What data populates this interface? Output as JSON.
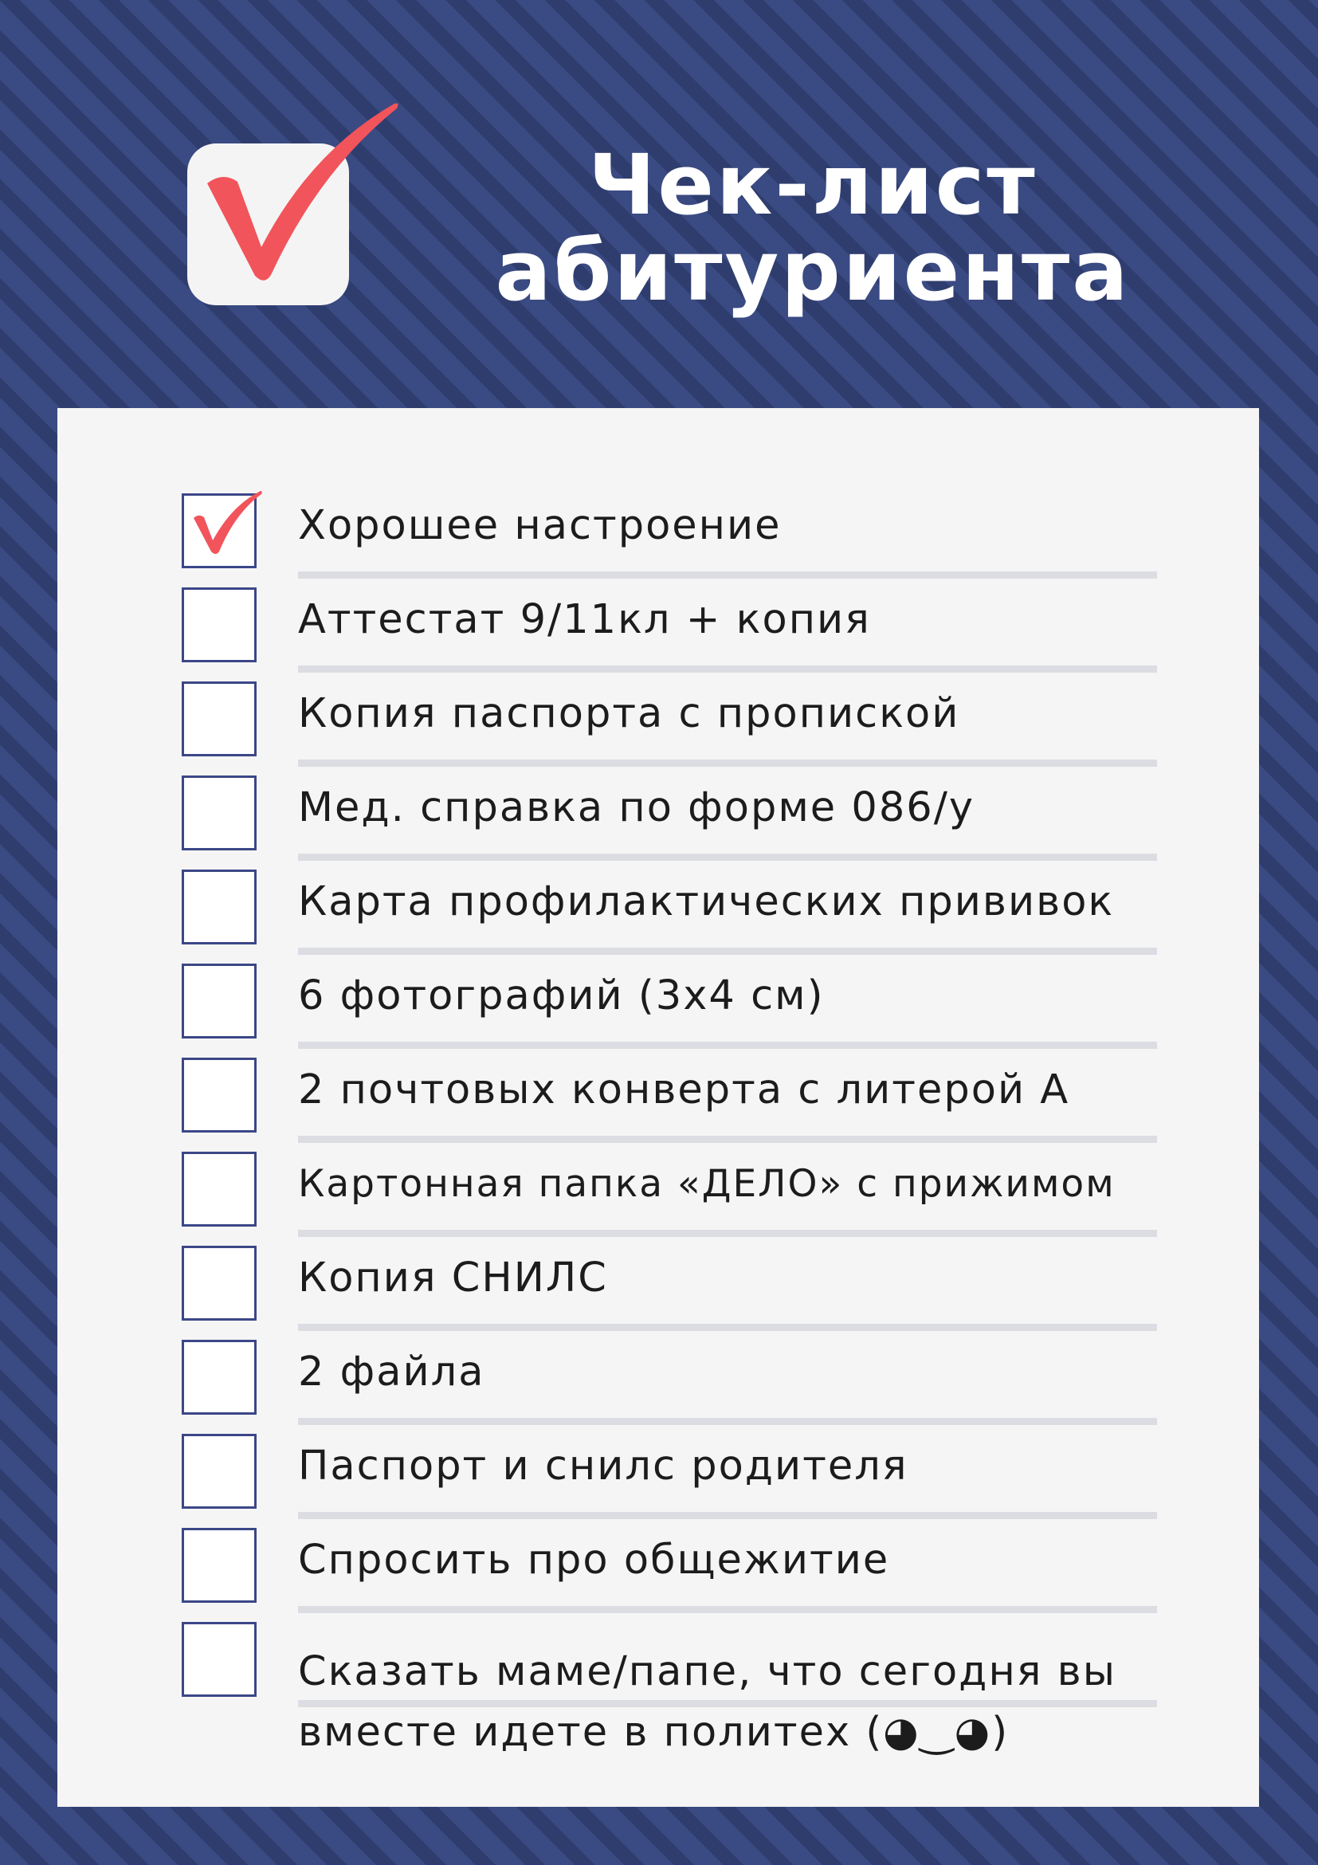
{
  "header": {
    "title_line1": "Чек-лист",
    "title_line2": "абитуриента",
    "logo_icon": "checkmark-icon",
    "accent_color": "#f2545b"
  },
  "checklist": {
    "items": [
      {
        "label": "Хорошее настроение",
        "checked": true
      },
      {
        "label": "Аттестат 9/11кл + копия",
        "checked": false
      },
      {
        "label": "Копия паспорта с пропиской",
        "checked": false
      },
      {
        "label": "Мед. справка по форме 086/у",
        "checked": false
      },
      {
        "label": "Карта профилактических прививок",
        "checked": false
      },
      {
        "label": "6 фотографий (3х4 см)",
        "checked": false
      },
      {
        "label": "2 почтовых конверта с литерой А",
        "checked": false
      },
      {
        "label": "Картонная папка «ДЕЛО» с прижимом",
        "checked": false
      },
      {
        "label": "Копия СНИЛС",
        "checked": false
      },
      {
        "label": "2 файла",
        "checked": false
      },
      {
        "label": "Паспорт и снилс родителя",
        "checked": false
      },
      {
        "label": "Спросить про общежитие",
        "checked": false
      },
      {
        "label": "Сказать маме/папе, что сегодня вы вместе идете в политех (◕‿◕)",
        "checked": false
      }
    ]
  }
}
